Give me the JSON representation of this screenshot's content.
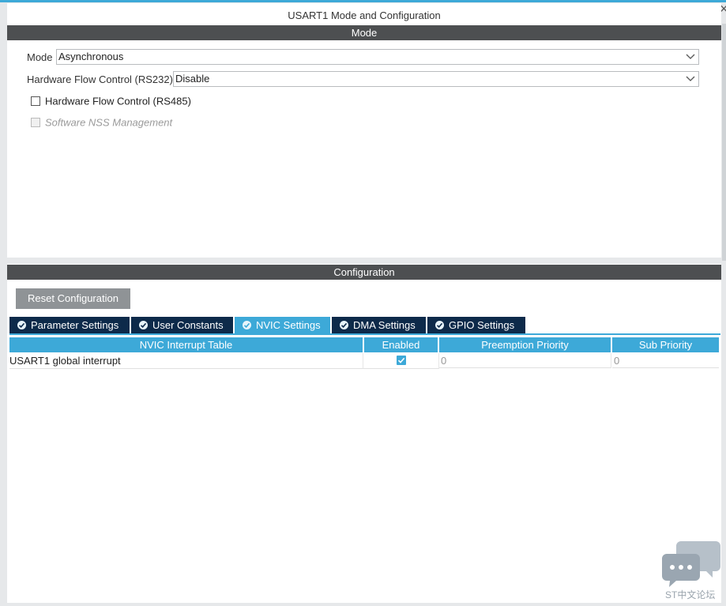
{
  "window": {
    "title": "USART1 Mode and Configuration"
  },
  "mode": {
    "section_title": "Mode",
    "mode_label": "Mode",
    "mode_value": "Asynchronous",
    "hwflow232_label": "Hardware Flow Control (RS232)",
    "hwflow232_value": "Disable",
    "hwflow485_label": "Hardware Flow Control (RS485)",
    "nss_label": "Software NSS Management"
  },
  "configuration": {
    "section_title": "Configuration",
    "reset_label": "Reset Configuration",
    "tabs": [
      {
        "label": "Parameter Settings"
      },
      {
        "label": "User Constants"
      },
      {
        "label": "NVIC Settings"
      },
      {
        "label": "DMA Settings"
      },
      {
        "label": "GPIO Settings"
      }
    ],
    "table": {
      "headers": [
        "NVIC Interrupt Table",
        "Enabled",
        "Preemption Priority",
        "Sub Priority"
      ],
      "rows": [
        {
          "name": "USART1 global interrupt",
          "enabled": true,
          "preemption": "0",
          "sub": "0"
        }
      ]
    }
  },
  "watermark": {
    "text": "ST中文论坛"
  },
  "colors": {
    "accent": "#3da9d8",
    "tab_dark": "#0d2a4a",
    "section_bar": "#4d4f51",
    "button_gray": "#8f9396"
  }
}
